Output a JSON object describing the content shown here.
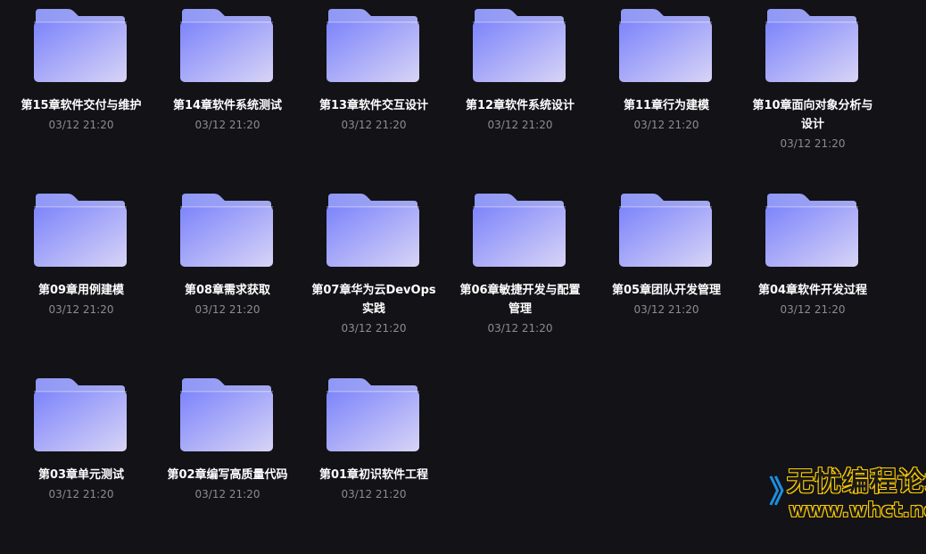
{
  "colors": {
    "background": "#121217",
    "folder_back": "#8f98f6",
    "folder_front_start": "#7c84fb",
    "folder_front_end": "#d8d4f6",
    "text": "#ffffff",
    "date_text": "#8b8b92"
  },
  "icon": "folder-icon",
  "folders": [
    {
      "name": "第15章软件交付与维护",
      "date": "03/12 21:20"
    },
    {
      "name": "第14章软件系统测试",
      "date": "03/12 21:20"
    },
    {
      "name": "第13章软件交互设计",
      "date": "03/12 21:20"
    },
    {
      "name": "第12章软件系统设计",
      "date": "03/12 21:20"
    },
    {
      "name": "第11章行为建模",
      "date": "03/12 21:20"
    },
    {
      "name": "第10章面向对象分析与设计",
      "date": "03/12 21:20"
    },
    {
      "name": "第09章用例建模",
      "date": "03/12 21:20"
    },
    {
      "name": "第08章需求获取",
      "date": "03/12 21:20"
    },
    {
      "name": "第07章华为云DevOps实践",
      "date": "03/12 21:20"
    },
    {
      "name": "第06章敏捷开发与配置管理",
      "date": "03/12 21:20"
    },
    {
      "name": "第05章团队开发管理",
      "date": "03/12 21:20"
    },
    {
      "name": "第04章软件开发过程",
      "date": "03/12 21:20"
    },
    {
      "name": "第03章单元测试",
      "date": "03/12 21:20"
    },
    {
      "name": "第02章编写高质量代码",
      "date": "03/12 21:20"
    },
    {
      "name": "第01章初识软件工程",
      "date": "03/12 21:20"
    }
  ],
  "watermark": {
    "title": "无忧编程论坛",
    "url": "www.whct.net"
  }
}
